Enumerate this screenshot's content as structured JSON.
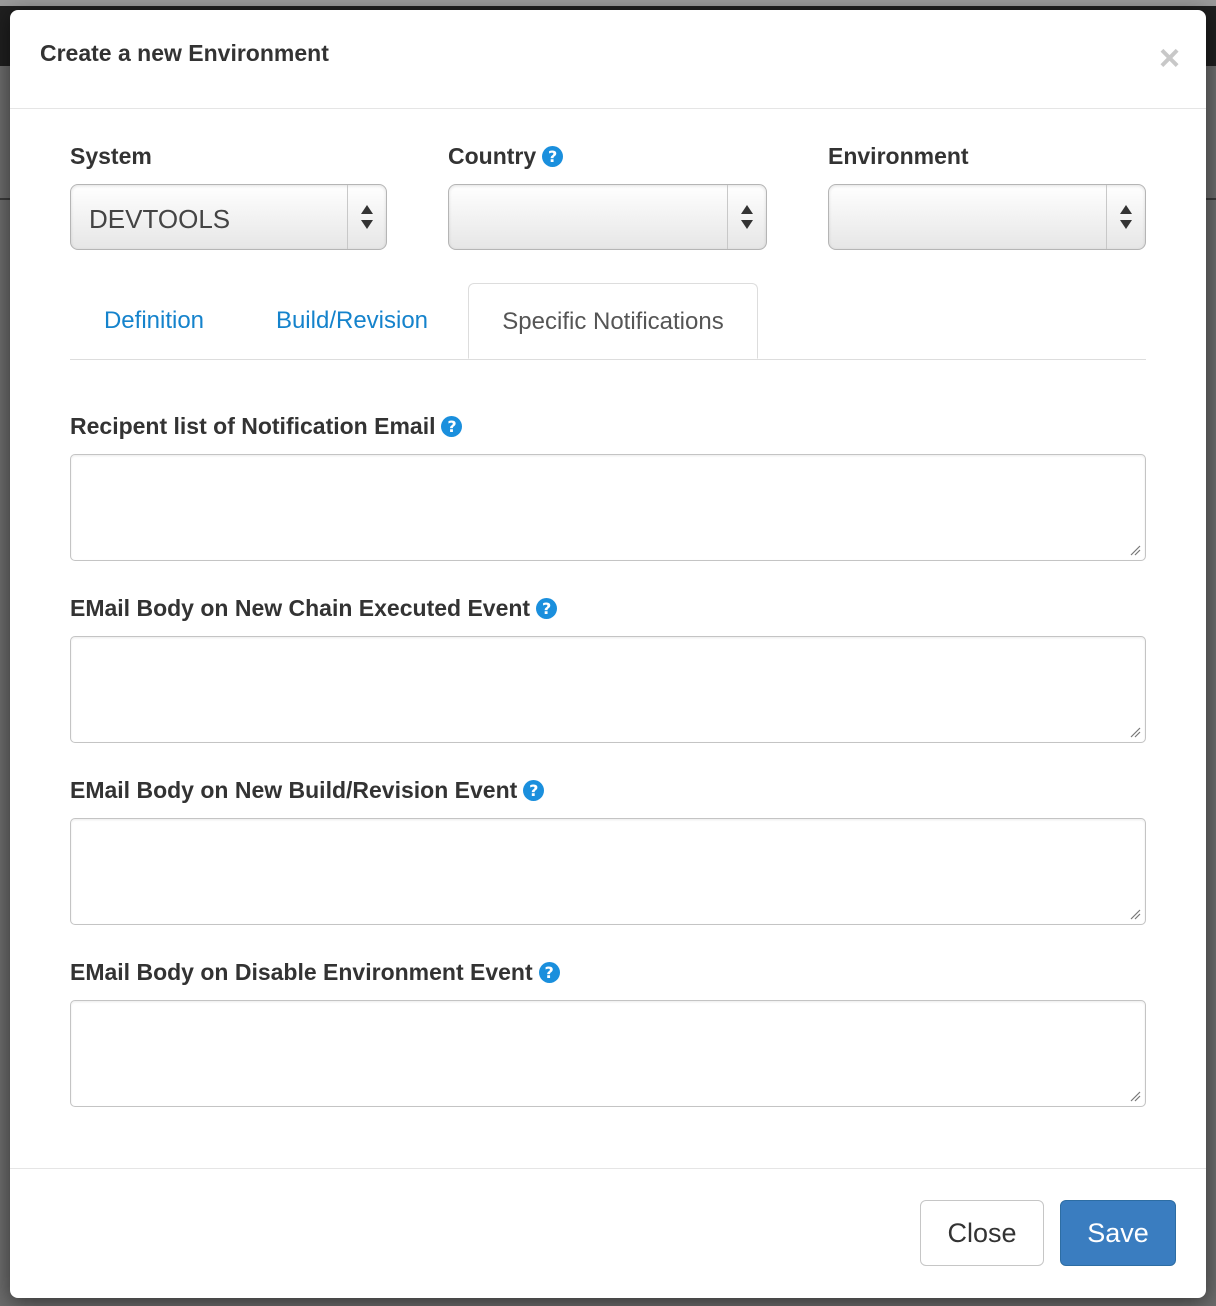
{
  "dialog": {
    "title": "Create a new Environment",
    "close_glyph": "×"
  },
  "fields": {
    "system": {
      "label": "System",
      "value": "DEVTOOLS"
    },
    "country": {
      "label": "Country",
      "value": ""
    },
    "environment": {
      "label": "Environment",
      "value": ""
    }
  },
  "tabs": [
    {
      "label": "Definition",
      "active": false
    },
    {
      "label": "Build/Revision",
      "active": false
    },
    {
      "label": "Specific Notifications",
      "active": true
    }
  ],
  "notifications": [
    {
      "label": "Recipent list of Notification Email",
      "value": ""
    },
    {
      "label": "EMail Body on New Chain Executed Event",
      "value": ""
    },
    {
      "label": "EMail Body on New Build/Revision Event",
      "value": ""
    },
    {
      "label": "EMail Body on Disable Environment Event",
      "value": ""
    }
  ],
  "footer": {
    "close_label": "Close",
    "save_label": "Save"
  },
  "help_glyph": "?",
  "colors": {
    "link": "#1583cc",
    "help_icon": "#1a8fdd",
    "primary_button": "#3a7dc0"
  }
}
